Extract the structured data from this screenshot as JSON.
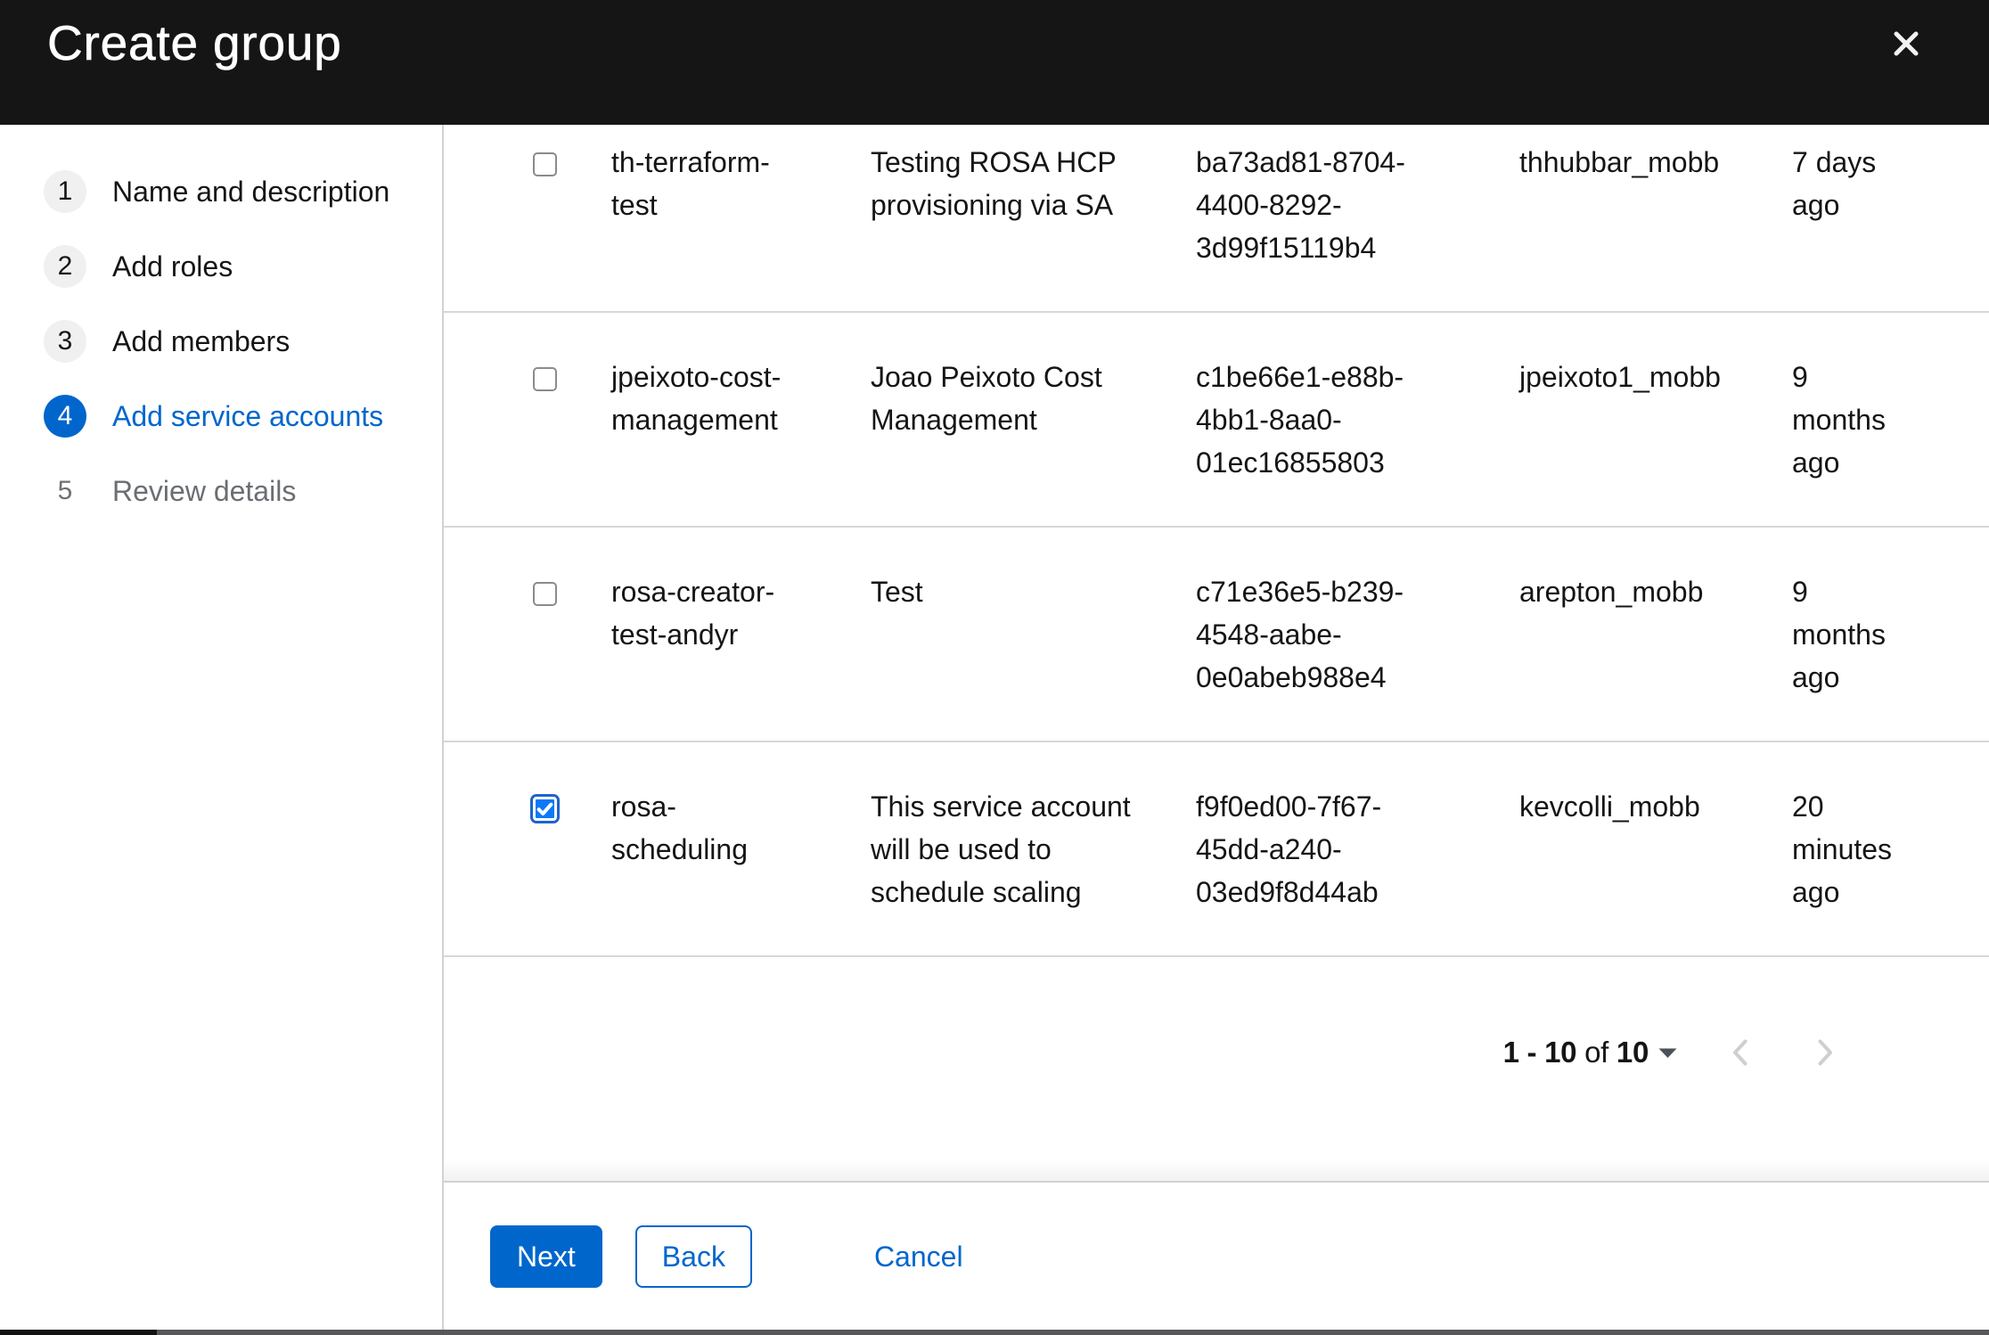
{
  "modal": {
    "title": "Create group"
  },
  "steps": [
    {
      "num": "1",
      "label": "Name and description",
      "state": "visited"
    },
    {
      "num": "2",
      "label": "Add roles",
      "state": "visited"
    },
    {
      "num": "3",
      "label": "Add members",
      "state": "visited"
    },
    {
      "num": "4",
      "label": "Add service accounts",
      "state": "current"
    },
    {
      "num": "5",
      "label": "Review details",
      "state": "disabled"
    }
  ],
  "table": {
    "rows": [
      {
        "checked": false,
        "name": "th-terraform-\ntest",
        "description": "Testing ROSA HCP\nprovisioning via SA",
        "client_id": "ba73ad81-8704-\n4400-8292-\n3d99f15119b4",
        "owner": "thhubbar_mobb",
        "time_created": "7 days\nago"
      },
      {
        "checked": false,
        "name": "jpeixoto-cost-\nmanagement",
        "description": "Joao Peixoto Cost\nManagement",
        "client_id": "c1be66e1-e88b-\n4bb1-8aa0-\n01ec16855803",
        "owner": "jpeixoto1_mobb",
        "time_created": "9\nmonths\nago"
      },
      {
        "checked": false,
        "name": "rosa-creator-\ntest-andyr",
        "description": "Test",
        "client_id": "c71e36e5-b239-\n4548-aabe-\n0e0abeb988e4",
        "owner": "arepton_mobb",
        "time_created": "9\nmonths\nago"
      },
      {
        "checked": true,
        "name": "rosa-\nscheduling",
        "description": "This service account\nwill be used to\nschedule scaling",
        "client_id": "f9f0ed00-7f67-\n45dd-a240-\n03ed9f8d44ab",
        "owner": "kevcolli_mobb",
        "time_created": "20\nminutes\nago"
      }
    ]
  },
  "pagination": {
    "range": "1 - 10",
    "of_label": "of",
    "total": "10"
  },
  "footer": {
    "next_label": "Next",
    "back_label": "Back",
    "cancel_label": "Cancel"
  },
  "colors": {
    "header_bg": "#151515",
    "accent_blue": "#0066cc",
    "checked_checkbox_fill": "#0d79f7",
    "text": "#151515",
    "muted_text": "#6a6e73",
    "divider": "#d2d2d2"
  }
}
